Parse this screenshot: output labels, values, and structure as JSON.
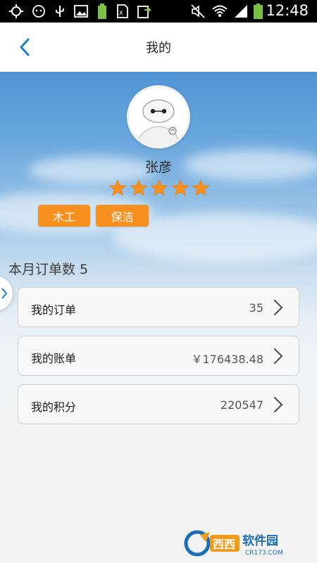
{
  "status_bar": {
    "time": "12:48",
    "icons": [
      "gps-icon",
      "notification-icon",
      "usb-icon",
      "image-icon",
      "battery-saver-icon",
      "sim-icon",
      "update-icon",
      "mute-icon",
      "wifi-icon",
      "signal-icon",
      "battery-icon"
    ]
  },
  "nav": {
    "title": "我的",
    "back_icon": "chevron-left-icon"
  },
  "profile": {
    "name": "张彦",
    "rating": 5,
    "rating_max": 5,
    "tags": [
      "木工",
      "保洁"
    ]
  },
  "month_orders_label": "本月订单数 5",
  "rows": [
    {
      "label": "我的订单",
      "value": "35"
    },
    {
      "label": "我的账单",
      "value": "￥176438.48"
    },
    {
      "label": "我的积分",
      "value": "220547"
    }
  ],
  "watermark": {
    "text": "西西软件园",
    "sub": "CR173.COM"
  },
  "colors": {
    "accent": "#1f7fd1",
    "tag_bg": "#f7901e",
    "star": "#f7901e",
    "row_border": "#cfcfcf"
  }
}
